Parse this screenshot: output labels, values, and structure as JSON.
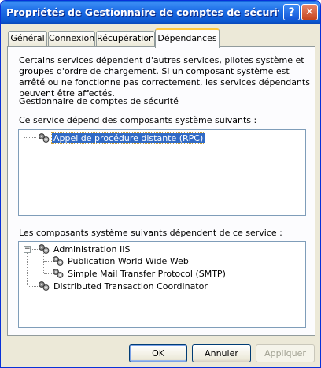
{
  "window": {
    "title": "Propriétés de Gestionnaire de comptes de sécurité (Or...",
    "help_glyph": "?",
    "close_glyph": "✕"
  },
  "tabs": [
    {
      "label": "Général",
      "active": false
    },
    {
      "label": "Connexion",
      "active": false
    },
    {
      "label": "Récupération",
      "active": false
    },
    {
      "label": "Dépendances",
      "active": true
    }
  ],
  "dependencies": {
    "description": "Certains services dépendent d'autres services, pilotes système et groupes d'ordre de chargement. Si un composant système est arrêté ou ne fonctionne pas correctement, les services dépendants peuvent être affectés.",
    "service_name": "Gestionnaire de comptes de sécurité",
    "depends_on_label": "Ce service dépend des composants système suivants :",
    "depends_on": [
      {
        "label": "Appel de procédure distante (RPC)",
        "selected": true,
        "icon": "service-gears-icon"
      }
    ],
    "dependents_label": "Les composants système suivants dépendent de ce service :",
    "dependents": [
      {
        "label": "Administration IIS",
        "expanded": true,
        "icon": "service-gears-icon",
        "children": [
          {
            "label": "Publication World Wide Web",
            "icon": "service-gears-icon"
          },
          {
            "label": "Simple Mail Transfer Protocol (SMTP)",
            "icon": "service-gears-icon"
          }
        ]
      },
      {
        "label": "Distributed Transaction Coordinator",
        "icon": "service-gears-icon"
      }
    ]
  },
  "buttons": {
    "ok": "OK",
    "cancel": "Annuler",
    "apply": "Appliquer"
  },
  "colors": {
    "title_bar": "#0b57d0",
    "selection": "#316ac5",
    "active_tab_accent": "#ffc83c"
  }
}
